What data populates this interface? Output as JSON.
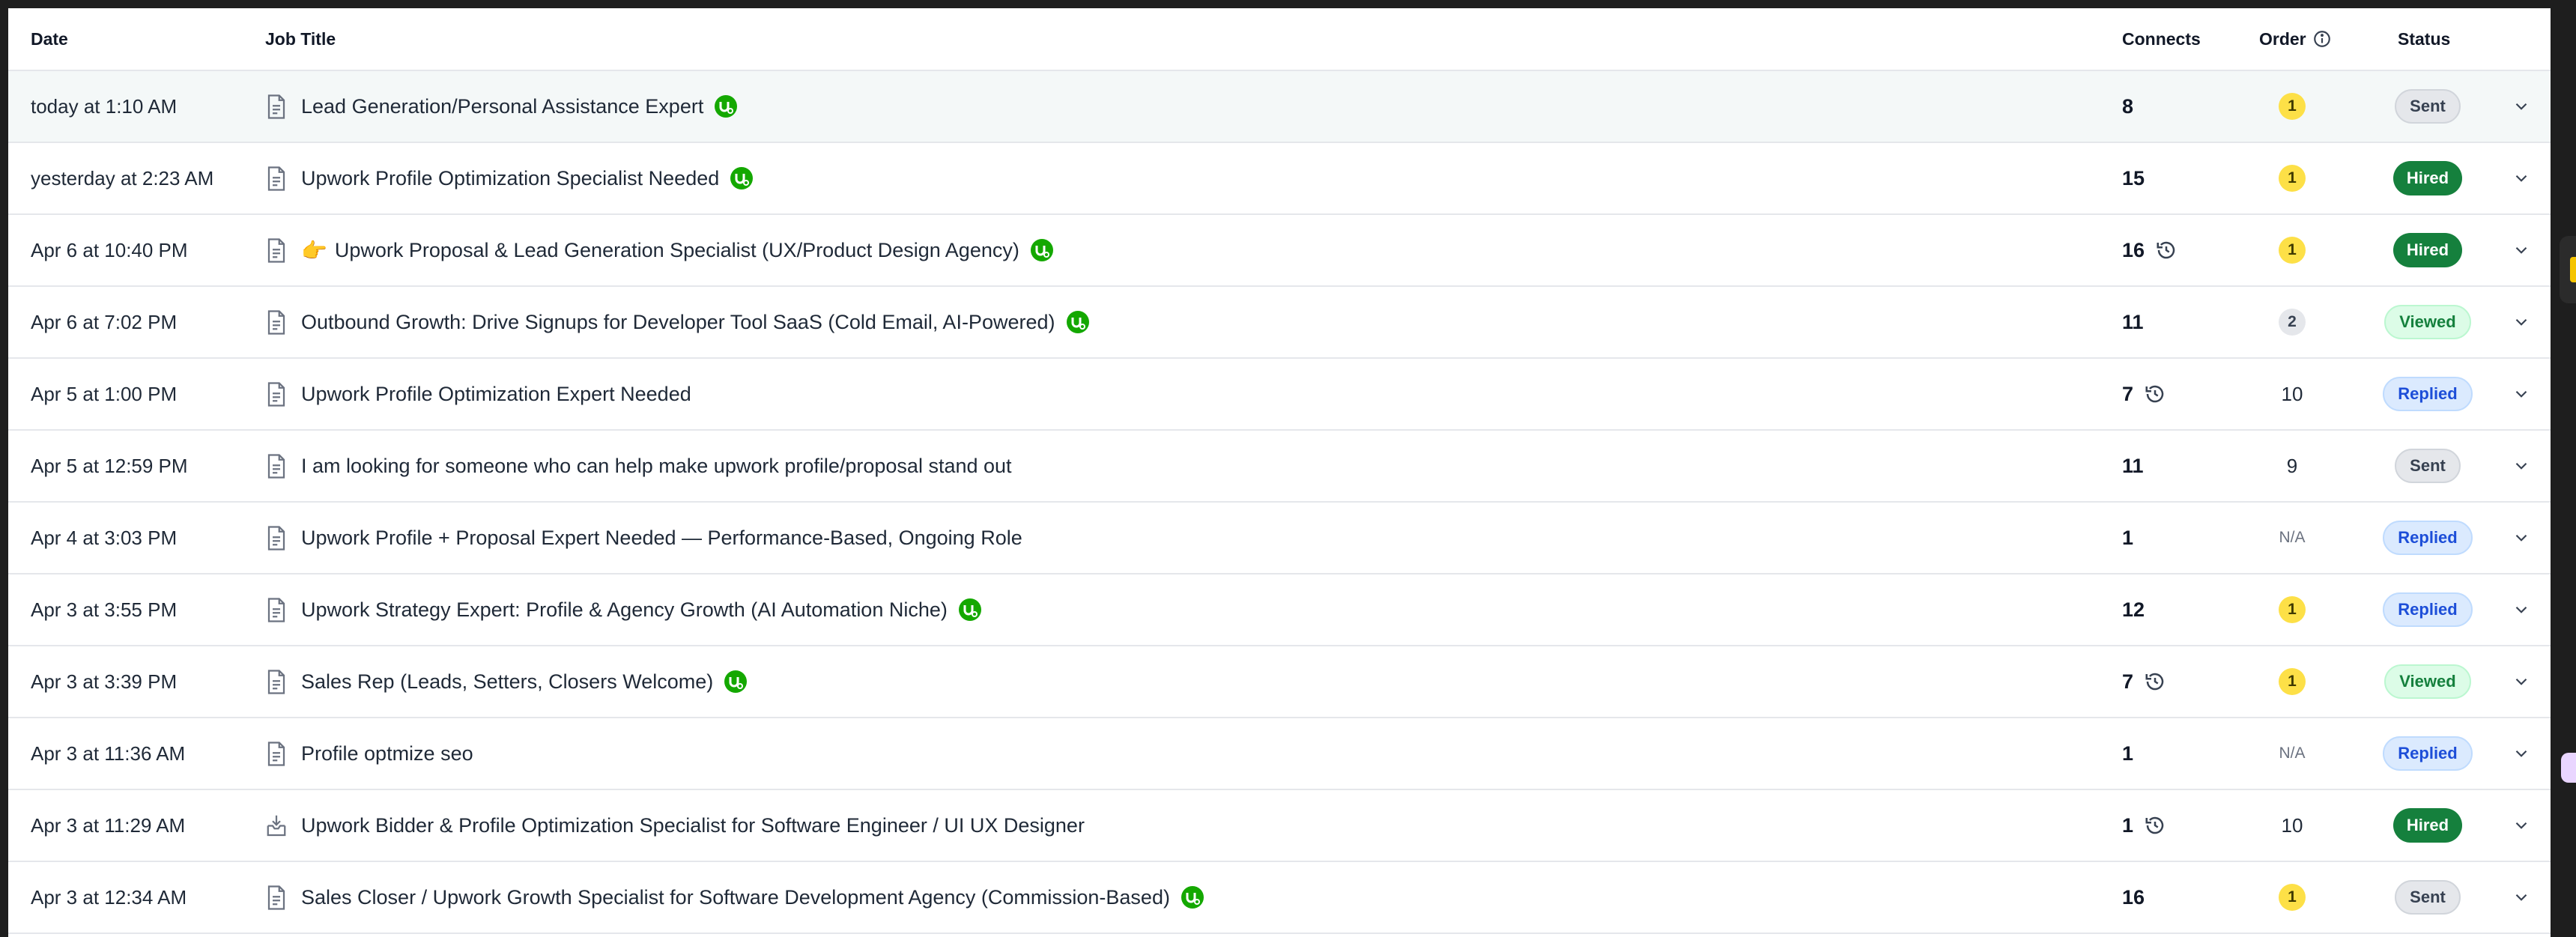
{
  "headers": {
    "date": "Date",
    "job_title": "Job Title",
    "connects": "Connects",
    "order": "Order",
    "status": "Status"
  },
  "colors": {
    "hired": "#15803d",
    "replied": "#1d4ed8",
    "viewed": "#15803d",
    "order_highlight": "#fde047"
  },
  "rows": [
    {
      "date": "today at 1:10 AM",
      "prefix": "",
      "title": "Lead Generation/Personal Assistance Expert",
      "badge": true,
      "connects": "8",
      "history": false,
      "order": "1",
      "order_style": "yellow",
      "status": "Sent",
      "status_style": "sent",
      "icon": "document-icon"
    },
    {
      "date": "yesterday at 2:23 AM",
      "prefix": "",
      "title": "Upwork Profile Optimization Specialist Needed",
      "badge": true,
      "connects": "15",
      "history": false,
      "order": "1",
      "order_style": "yellow",
      "status": "Hired",
      "status_style": "hired",
      "icon": "document-icon"
    },
    {
      "date": "Apr 6 at 10:40 PM",
      "prefix": "👉",
      "title": "Upwork Proposal & Lead Generation Specialist (UX/Product Design Agency)",
      "badge": true,
      "connects": "16",
      "history": true,
      "order": "1",
      "order_style": "yellow",
      "status": "Hired",
      "status_style": "hired",
      "icon": "document-icon"
    },
    {
      "date": "Apr 6 at 7:02 PM",
      "prefix": "",
      "title": "Outbound Growth: Drive Signups for Developer Tool SaaS (Cold Email, AI-Powered)",
      "badge": true,
      "connects": "11",
      "history": false,
      "order": "2",
      "order_style": "gray",
      "status": "Viewed",
      "status_style": "viewed",
      "icon": "document-icon"
    },
    {
      "date": "Apr 5 at 1:00 PM",
      "prefix": "",
      "title": "Upwork Profile Optimization Expert Needed",
      "badge": false,
      "connects": "7",
      "history": true,
      "order": "10",
      "order_style": "plain",
      "status": "Replied",
      "status_style": "replied",
      "icon": "document-icon"
    },
    {
      "date": "Apr 5 at 12:59 PM",
      "prefix": "",
      "title": "I am looking for someone who can help make upwork profile/proposal stand out",
      "badge": false,
      "connects": "11",
      "history": false,
      "order": "9",
      "order_style": "plain",
      "status": "Sent",
      "status_style": "sent",
      "icon": "document-icon"
    },
    {
      "date": "Apr 4 at 3:03 PM",
      "prefix": "",
      "title": "Upwork Profile + Proposal Expert Needed — Performance-Based, Ongoing Role",
      "badge": false,
      "connects": "1",
      "history": false,
      "order": "N/A",
      "order_style": "na",
      "status": "Replied",
      "status_style": "replied",
      "icon": "document-icon"
    },
    {
      "date": "Apr 3 at 3:55 PM",
      "prefix": "",
      "title": "Upwork Strategy Expert: Profile & Agency Growth (AI Automation Niche)",
      "badge": true,
      "connects": "12",
      "history": false,
      "order": "1",
      "order_style": "yellow",
      "status": "Replied",
      "status_style": "replied",
      "icon": "document-icon"
    },
    {
      "date": "Apr 3 at 3:39 PM",
      "prefix": "",
      "title": "Sales Rep (Leads, Setters, Closers Welcome)",
      "badge": true,
      "connects": "7",
      "history": true,
      "order": "1",
      "order_style": "yellow",
      "status": "Viewed",
      "status_style": "viewed",
      "icon": "document-icon"
    },
    {
      "date": "Apr 3 at 11:36 AM",
      "prefix": "",
      "title": "Profile optmize seo",
      "badge": false,
      "connects": "1",
      "history": false,
      "order": "N/A",
      "order_style": "na",
      "status": "Replied",
      "status_style": "replied",
      "icon": "document-icon"
    },
    {
      "date": "Apr 3 at 11:29 AM",
      "prefix": "",
      "title": "Upwork Bidder & Profile Optimization Specialist for Software Engineer / UI UX Designer",
      "badge": false,
      "connects": "1",
      "history": true,
      "order": "10",
      "order_style": "plain",
      "status": "Hired",
      "status_style": "hired",
      "icon": "inbox-download-icon"
    },
    {
      "date": "Apr 3 at 12:34 AM",
      "prefix": "",
      "title": "Sales Closer / Upwork Growth Specialist for Software Development Agency (Commission-Based)",
      "badge": true,
      "connects": "16",
      "history": false,
      "order": "1",
      "order_style": "yellow",
      "status": "Sent",
      "status_style": "sent",
      "icon": "document-icon"
    }
  ]
}
